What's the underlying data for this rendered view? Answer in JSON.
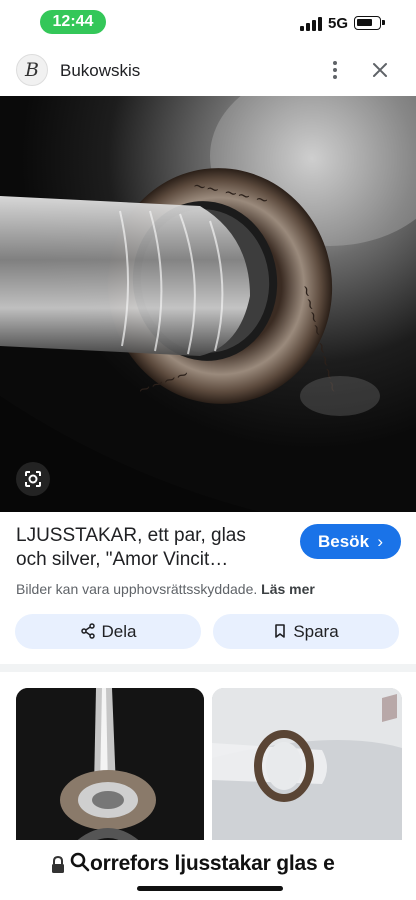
{
  "status_bar": {
    "time": "12:44",
    "network": "5G"
  },
  "header": {
    "site_logo_letter": "B",
    "site_name": "Bukowskis"
  },
  "result": {
    "title_line1": "LJUSSTAKAR, ett par, glas",
    "title_line2": "och silver, \"Amor Vincit…",
    "visit_label": "Besök",
    "copyright_text": "Bilder kan vara upphovsrättsskyddade.",
    "read_more_label": "Läs mer"
  },
  "actions": {
    "share_label": "Dela",
    "save_label": "Spara"
  },
  "url_bar": {
    "text": "orrefors ljusstakar glas e"
  },
  "colors": {
    "accent": "#1a73e8",
    "chip_bg": "#e8f0fe",
    "time_pill": "#34c759"
  }
}
